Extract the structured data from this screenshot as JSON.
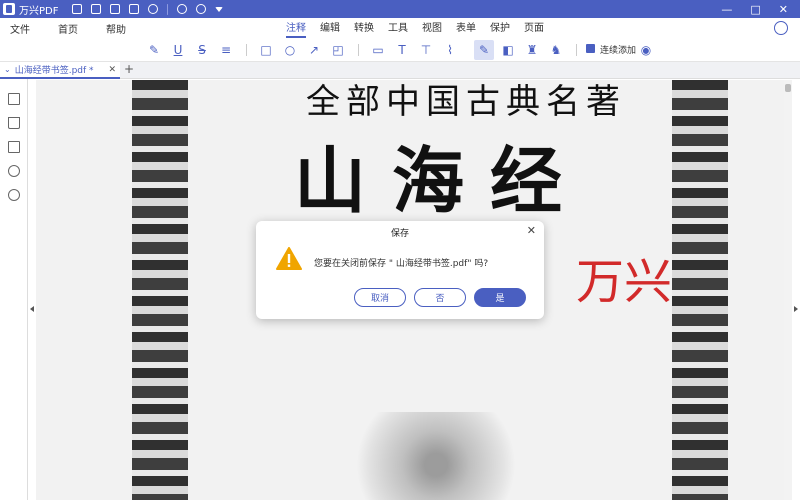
{
  "app": {
    "title": "万兴PDF"
  },
  "menu": {
    "file": "文件",
    "home": "首页",
    "help": "帮助"
  },
  "ribbon_tabs": [
    "注释",
    "编辑",
    "转换",
    "工具",
    "视图",
    "表单",
    "保护",
    "页面"
  ],
  "toolbar": {
    "continuous_add_label": "连续添加"
  },
  "document_tab": {
    "name": "山海经带书签.pdf *"
  },
  "page": {
    "title_top": "全部中国古典名著",
    "title_big": "山海经",
    "signature": "万兴"
  },
  "dialog": {
    "title": "保存",
    "message": "您要在关闭前保存 \" 山海经带书签.pdf\" 吗?",
    "cancel": "取消",
    "no": "否",
    "yes": "是"
  },
  "colors": {
    "accent": "#4a5fc1",
    "warning": "#f0a500",
    "ink_red": "#d22a2a"
  }
}
